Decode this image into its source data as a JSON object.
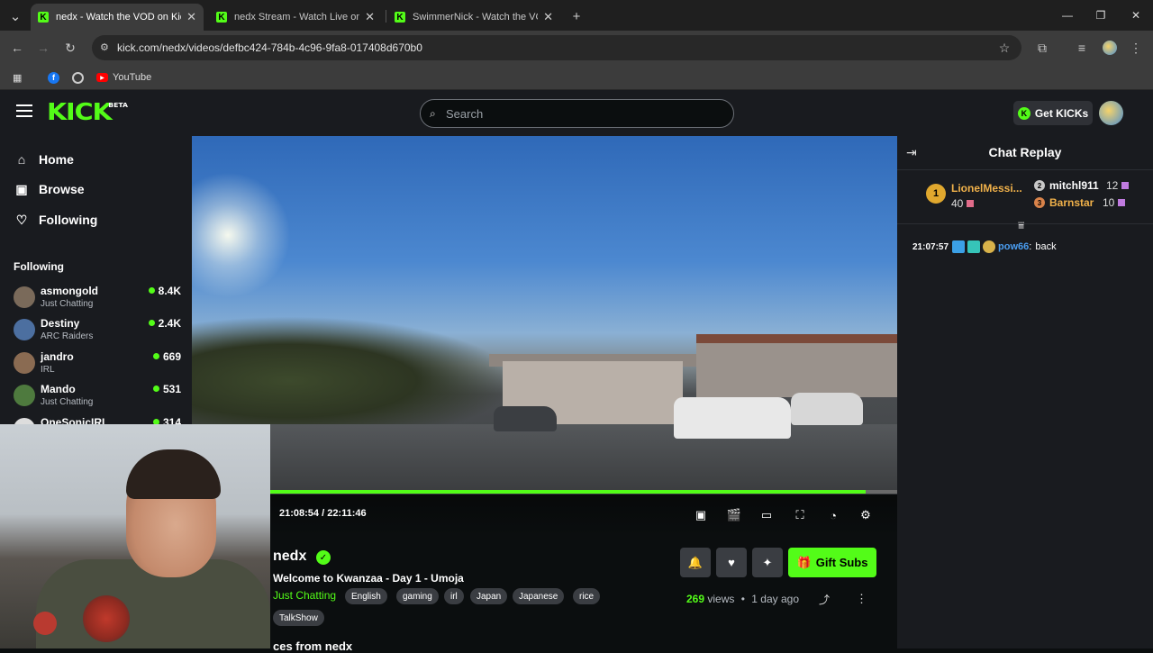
{
  "browser": {
    "tabs": [
      {
        "title": "nedx - Watch the VOD on Kick",
        "active": true
      },
      {
        "title": "nedx Stream - Watch Live on Ki",
        "active": false
      },
      {
        "title": "SwimmerNick - Watch the VOD",
        "active": false
      }
    ],
    "url": "kick.com/nedx/videos/defbc424-784b-4c96-9fa8-017408d670b0",
    "bookmarks": [
      {
        "label": "",
        "icon": "facebook-icon"
      },
      {
        "label": "",
        "icon": "globe-icon"
      },
      {
        "label": "YouTube",
        "icon": "youtube-icon"
      }
    ]
  },
  "kick": {
    "logo_text": "KICK",
    "logo_badge": "BETA",
    "search_placeholder": "Search",
    "get_kicks_label": "Get KICKs",
    "accent_color": "#53fc18"
  },
  "sidebar": {
    "nav": [
      {
        "label": "Home",
        "icon": "home-icon"
      },
      {
        "label": "Browse",
        "icon": "browse-icon"
      },
      {
        "label": "Following",
        "icon": "heart-icon"
      }
    ],
    "following_heading": "Following",
    "following": [
      {
        "name": "asmongold",
        "category": "Just Chatting",
        "viewers": "8.4K"
      },
      {
        "name": "Destiny",
        "category": "ARC Raiders",
        "viewers": "2.4K"
      },
      {
        "name": "jandro",
        "category": "IRL",
        "viewers": "669"
      },
      {
        "name": "Mando",
        "category": "Just Chatting",
        "viewers": "531"
      },
      {
        "name": "OneSonicIRL",
        "category": "",
        "viewers": "314"
      }
    ]
  },
  "player": {
    "current_time": "21:08:54",
    "total_time": "22:11:46",
    "time_display": "21:08:54 / 22:11:46",
    "progress_fraction": 0.95
  },
  "video_info": {
    "channel": "nedx",
    "title": "Welcome to Kwanzaa - Day 1 - Umoja",
    "category": "Just Chatting",
    "tags": [
      "English",
      "gaming",
      "irl",
      "Japan",
      "Japanese",
      "rice",
      "TalkShow"
    ],
    "gift_subs_label": "Gift Subs",
    "views_count": "269",
    "views_label": "views",
    "separator": "•",
    "age": "1 day ago",
    "below_text": "ces from nedx"
  },
  "chat": {
    "title": "Chat Replay",
    "leaderboard": [
      {
        "rank": "1",
        "name": "LionelMessi...",
        "count": "40"
      },
      {
        "rank": "2",
        "name": "mitchl911",
        "count": "12"
      },
      {
        "rank": "3",
        "name": "Barnstar",
        "count": "10"
      }
    ],
    "messages": [
      {
        "time": "21:07:57",
        "user": "pow66",
        "text": "back"
      }
    ]
  }
}
